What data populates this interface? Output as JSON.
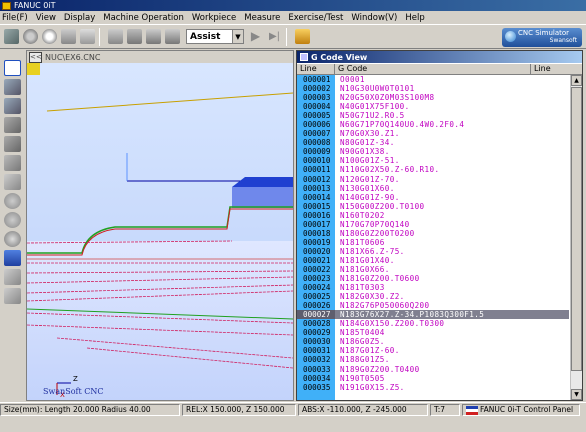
{
  "window": {
    "title": "FANUC 0iT"
  },
  "menu": [
    "File(F)",
    "View",
    "Display",
    "Machine Operation",
    "Workpiece",
    "Measure",
    "Exercise/Test",
    "Window(V)",
    "Help"
  ],
  "toolbar": {
    "mode_value": "Assist",
    "brand_line1": "CNC Simulator",
    "brand_line2": "Swansoft"
  },
  "view": {
    "title": "NUC\\EX6.CNC",
    "collapse_label": "<<",
    "watermark": "SwanSoft CNC",
    "axis_z": "Z",
    "axis_x": "X"
  },
  "code_view": {
    "title": "G Code View",
    "col_line": "Line",
    "col_code": "G Code",
    "col_line2": "Line",
    "selected_index": 26,
    "rows": [
      {
        "line": "000001",
        "code": "O0001"
      },
      {
        "line": "000002",
        "code": "N10G30U0W0T0101"
      },
      {
        "line": "000003",
        "code": "N20G50X0Z0M03S100M8"
      },
      {
        "line": "000004",
        "code": "N40G01X75F100."
      },
      {
        "line": "000005",
        "code": "N50G71U2.R0.5"
      },
      {
        "line": "000006",
        "code": "N60G71P70Q140U0.4W0.2F0.4"
      },
      {
        "line": "000007",
        "code": "N70G0X30.Z1."
      },
      {
        "line": "000008",
        "code": "N80G01Z-34."
      },
      {
        "line": "000009",
        "code": "N90G01X38."
      },
      {
        "line": "000010",
        "code": "N100G01Z-51."
      },
      {
        "line": "000011",
        "code": "N110G02X50.Z-60.R10."
      },
      {
        "line": "000012",
        "code": "N120G01Z-70."
      },
      {
        "line": "000013",
        "code": "N130G01X60."
      },
      {
        "line": "000014",
        "code": "N140G01Z-90."
      },
      {
        "line": "000015",
        "code": "N150G00Z200.T0100"
      },
      {
        "line": "000016",
        "code": "N160T0202"
      },
      {
        "line": "000017",
        "code": "N170G70P70Q140"
      },
      {
        "line": "000018",
        "code": "N180G0Z200T0200"
      },
      {
        "line": "000019",
        "code": "N181T0606"
      },
      {
        "line": "000020",
        "code": "N181X66.Z-75."
      },
      {
        "line": "000021",
        "code": "N181G01X40."
      },
      {
        "line": "000022",
        "code": "N181G0X66."
      },
      {
        "line": "000023",
        "code": "N181G0Z200.T0600"
      },
      {
        "line": "000024",
        "code": "N181T0303"
      },
      {
        "line": "000025",
        "code": "N182G0X30.Z2."
      },
      {
        "line": "000026",
        "code": "N182G76P050060Q200"
      },
      {
        "line": "000027",
        "code": "N183G76X27.Z-34.P1083Q300F1.5"
      },
      {
        "line": "000028",
        "code": "N184G0X150.Z200.T0300"
      },
      {
        "line": "000029",
        "code": "N185T0404"
      },
      {
        "line": "000030",
        "code": "N186G0Z5."
      },
      {
        "line": "000031",
        "code": "N187G01Z-60."
      },
      {
        "line": "000032",
        "code": "N188G01Z5."
      },
      {
        "line": "000033",
        "code": "N189G0Z200.T0400"
      },
      {
        "line": "000034",
        "code": "N190T0505"
      },
      {
        "line": "000035",
        "code": "N191G0X15.Z5."
      }
    ]
  },
  "status": {
    "size": "Size(mm): Length  20.000 Radius  40.00",
    "rel": "REL:X  150.000,  Z  150.000",
    "abs": "ABS:X -110.000,  Z -245.000",
    "tool": "T:7",
    "panel": "FANUC 0i-T Control Panel"
  },
  "colors": {
    "accent": "#0a246a",
    "line_col": "#40b0f8",
    "code_text": "#c000c0",
    "selected_row": "#808090"
  }
}
